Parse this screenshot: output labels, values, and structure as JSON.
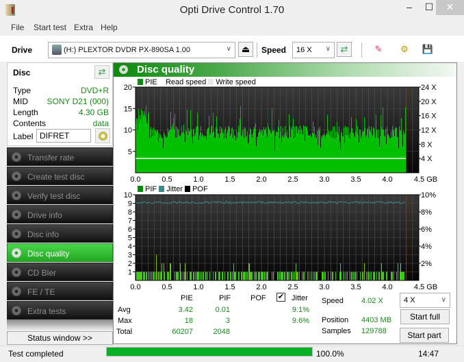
{
  "window": {
    "title": "Opti Drive Control 1.70",
    "min": "–",
    "max": "☐",
    "close": "✕"
  },
  "menu": [
    "File",
    "Start test",
    "Extra",
    "Help"
  ],
  "toolbar": {
    "drive_label": "Drive",
    "drive_value": "(H:)  PLEXTOR DVDR   PX-890SA 1.00",
    "speed_label": "Speed",
    "speed_value": "16 X",
    "eject": "⏏",
    "refresh": "⇄",
    "erase": "✎",
    "settings": "⚙",
    "save": "💾"
  },
  "disc": {
    "title": "Disc",
    "rows": [
      {
        "k": "Type",
        "v": "DVD+R"
      },
      {
        "k": "MID",
        "v": "SONY D21 (000)"
      },
      {
        "k": "Length",
        "v": "4.30 GB"
      },
      {
        "k": "Contents",
        "v": "data"
      }
    ],
    "label_key": "Label",
    "label_value": "DIFRET"
  },
  "nav": [
    {
      "label": "Transfer rate",
      "active": false
    },
    {
      "label": "Create test disc",
      "active": false
    },
    {
      "label": "Verify test disc",
      "active": false
    },
    {
      "label": "Drive info",
      "active": false
    },
    {
      "label": "Disc info",
      "active": false
    },
    {
      "label": "Disc quality",
      "active": true
    },
    {
      "label": "CD Bler",
      "active": false
    },
    {
      "label": "FE / TE",
      "active": false
    },
    {
      "label": "Extra tests",
      "active": false
    }
  ],
  "status_window": "Status window >>",
  "section": {
    "title": "Disc quality"
  },
  "chart_data": [
    {
      "type": "bar",
      "title": "PIE",
      "legend": [
        "PIE",
        "Read speed",
        "Write speed"
      ],
      "colors": {
        "PIE": "#00c000",
        "read": "#ffffff",
        "write": "#e8e8e8",
        "end": "#ff0000"
      },
      "x_ticks": [
        "0.0",
        "0.5",
        "1.0",
        "1.5",
        "2.0",
        "2.5",
        "3.0",
        "3.5",
        "4.0",
        "4.5 GB"
      ],
      "xlim": [
        0,
        4.5
      ],
      "y_ticks": [
        "5",
        "10",
        "15",
        "20"
      ],
      "ylim": [
        0,
        20
      ],
      "y2_ticks": [
        "4 X",
        "8 X",
        "12 X",
        "16 X",
        "20 X",
        "24 X"
      ],
      "y2lim": [
        0,
        24
      ],
      "end_gb": 4.3,
      "read_speed_x": 4.02,
      "pie_base": 9.5,
      "pie_max": 18,
      "pie_avg": 3.42
    },
    {
      "type": "bar",
      "title": "PIF / Jitter",
      "legend": [
        "PIF",
        "Jitter",
        "POF"
      ],
      "colors": {
        "PIF": "#3ccc14",
        "Jitter": "#3a8a8a",
        "POF": "#000000"
      },
      "x_ticks": [
        "0.0",
        "0.5",
        "1.0",
        "1.5",
        "2.0",
        "2.5",
        "3.0",
        "3.5",
        "4.0",
        "4.5 GB"
      ],
      "xlim": [
        0,
        4.5
      ],
      "y_ticks": [
        "1",
        "2",
        "3",
        "4",
        "5",
        "6",
        "7",
        "8",
        "9",
        "10"
      ],
      "ylim": [
        0,
        10
      ],
      "y2_ticks": [
        "2%",
        "4%",
        "6%",
        "8%",
        "10%"
      ],
      "y2lim": [
        0,
        10
      ],
      "jitter_pct": 9.1,
      "pif_max": 3,
      "end_gb": 4.3
    }
  ],
  "stats": {
    "headers": [
      "PIE",
      "PIF",
      "POF",
      "Jitter"
    ],
    "jitter_checked": true,
    "rows": [
      {
        "k": "Avg",
        "pie": "3.42",
        "pif": "0.01",
        "jit": "9.1%"
      },
      {
        "k": "Max",
        "pie": "18",
        "pif": "3",
        "jit": "9.6%"
      },
      {
        "k": "Total",
        "pie": "60207",
        "pif": "2048",
        "jit": ""
      }
    ]
  },
  "run": {
    "speed_label": "Speed",
    "speed_value": "4.02 X",
    "position_label": "Position",
    "position_value": "4403 MB",
    "samples_label": "Samples",
    "samples_value": "129788",
    "speed_select": "4 X",
    "start_full": "Start full",
    "start_part": "Start part"
  },
  "status": {
    "text": "Test completed",
    "progress_pct": 100,
    "progress_text": "100.0%",
    "time": "14:47"
  }
}
